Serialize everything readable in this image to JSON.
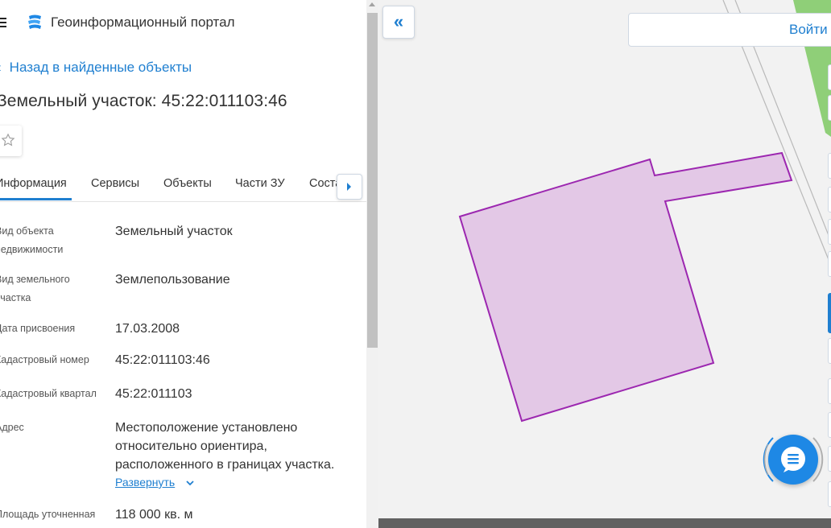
{
  "header": {
    "app_title": "Геоинформационный портал",
    "back_link": "Назад в найденные объекты",
    "object_title": "Земельный участок: 45:22:011103:46"
  },
  "tabs": [
    {
      "label": "Информация",
      "active": true
    },
    {
      "label": "Сервисы"
    },
    {
      "label": "Объекты"
    },
    {
      "label": "Части ЗУ"
    },
    {
      "label": "Соста"
    }
  ],
  "fields": [
    {
      "label": "Вид объекта недвижимости",
      "value": "Земельный участок"
    },
    {
      "label": "Вид земельного участка",
      "value": "Землепользование"
    },
    {
      "label": "Дата присвоения",
      "value": "17.03.2008"
    },
    {
      "label": "Кадастровый номер",
      "value": "45:22:011103:46"
    },
    {
      "label": "Кадастровый квартал",
      "value": "45:22:011103"
    },
    {
      "label": "Адрес",
      "value": "Местоположение установлено относительно ориентира, расположенного в границах участка."
    },
    {
      "label": "Площадь уточненная",
      "value": "118 000 кв. м"
    }
  ],
  "address_expand": "Развернуть",
  "map": {
    "login_label": "Войти",
    "collapse_label": "«",
    "parcel_fill": "#e3c8e6",
    "parcel_stroke": "#9c27b0"
  },
  "colors": {
    "accent": "#1f7fd0",
    "map_background": "#f2f2f2",
    "green_area": "#8fcf78"
  },
  "icons": {
    "menu": "hamburger-icon",
    "logo": "portal-logo-icon",
    "back": "chevron-left-icon",
    "favorite": "star-icon",
    "tab_next": "triangle-right-icon",
    "expand": "chevron-down-icon",
    "chat": "chat-icon"
  }
}
